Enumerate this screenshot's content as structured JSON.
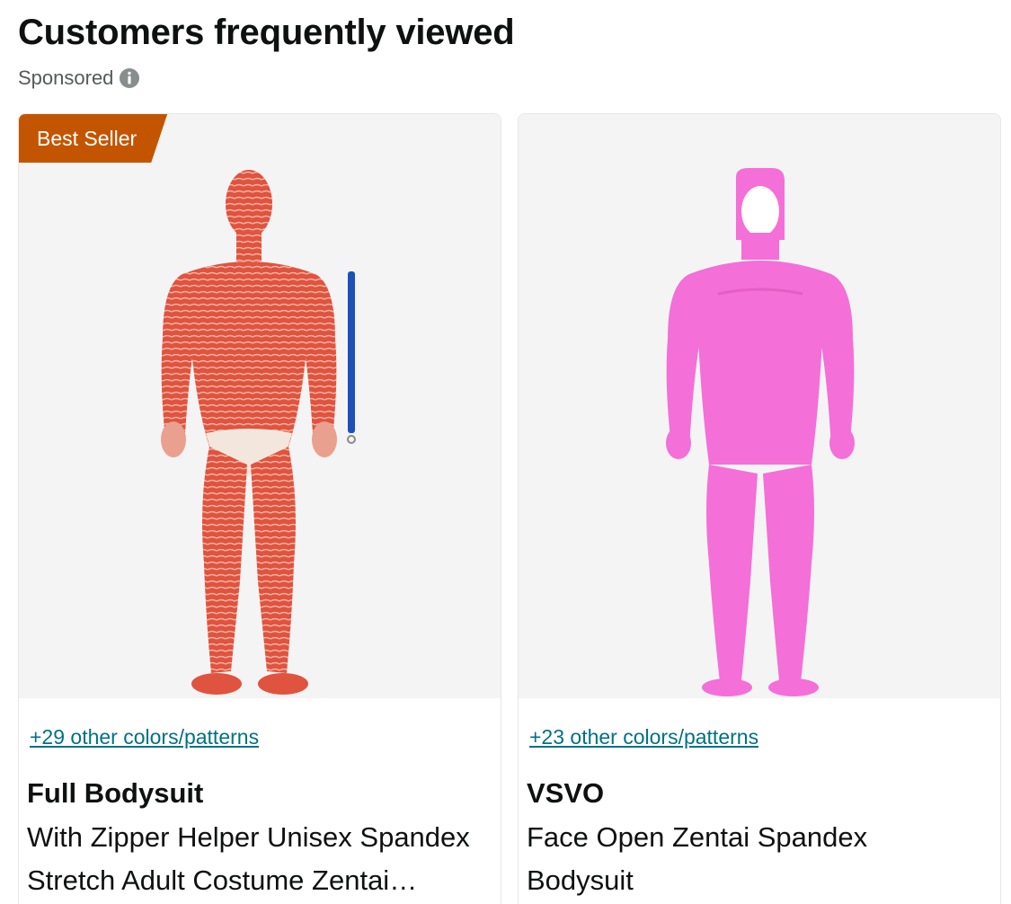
{
  "section": {
    "title": "Customers frequently viewed",
    "sponsored_label": "Sponsored",
    "info_icon": "info-circle-icon"
  },
  "products": [
    {
      "badge": "Best Seller",
      "image": "red-muscle-print-bodysuit-with-blue-lanyard",
      "colors_link": "+29 other colors/patterns",
      "brand": "Full Bodysuit",
      "title_line1": "With Zipper Helper Unisex Spandex",
      "title_line2": "Stretch Adult Costume Zentai…"
    },
    {
      "image": "pink-face-open-zentai-bodysuit",
      "colors_link": "+23 other colors/patterns",
      "brand": "VSVO",
      "title_line1": "Face Open Zentai Spandex",
      "title_line2": "Bodysuit"
    }
  ],
  "colors": {
    "badge": "#c45500",
    "link": "#007185",
    "muscle_red": "#e0533f",
    "suit_pink": "#f46fd7",
    "lanyard_blue": "#1f4fb8"
  }
}
